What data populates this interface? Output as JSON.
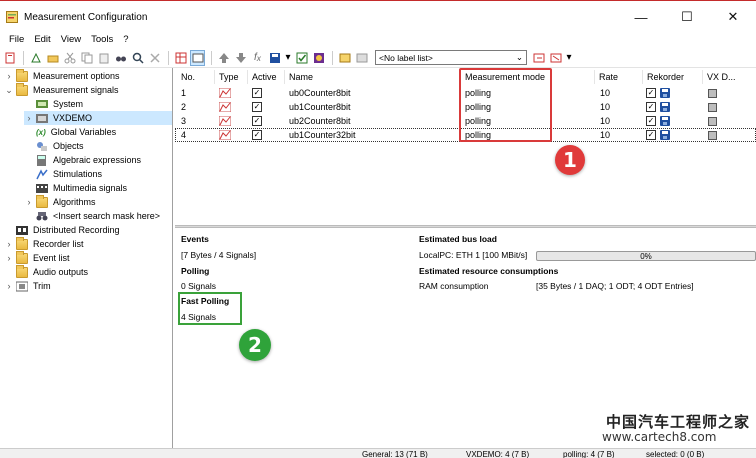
{
  "window": {
    "title": "Measurement Configuration",
    "minimize": "—",
    "maximize": "☐",
    "close": "✕"
  },
  "menu": [
    "File",
    "Edit",
    "View",
    "Tools",
    "?"
  ],
  "toolbar": {
    "label_list": "<No label list>"
  },
  "tree": {
    "items": [
      {
        "label": "Measurement options",
        "chev": "›"
      },
      {
        "label": "Measurement signals",
        "chev": "⌄"
      },
      {
        "label": "System",
        "chev": ""
      },
      {
        "label": "VXDEMO",
        "chev": "›"
      },
      {
        "label": "Global Variables",
        "chev": "",
        "prefix": "(x)"
      },
      {
        "label": "Objects",
        "chev": ""
      },
      {
        "label": "Algebraic expressions",
        "chev": ""
      },
      {
        "label": "Stimulations",
        "chev": ""
      },
      {
        "label": "Multimedia signals",
        "chev": ""
      },
      {
        "label": "Algorithms",
        "chev": "›"
      },
      {
        "label": "<Insert search mask here>",
        "chev": ""
      },
      {
        "label": "Distributed Recording",
        "chev": ""
      },
      {
        "label": "Recorder list",
        "chev": "›"
      },
      {
        "label": "Event list",
        "chev": "›"
      },
      {
        "label": "Audio outputs",
        "chev": ""
      },
      {
        "label": "Trim",
        "chev": "›"
      }
    ]
  },
  "grid": {
    "headers": [
      "No.",
      "Type",
      "Active",
      "Name",
      "Measurement mode",
      "Rate",
      "Rekorder",
      "VX D..."
    ],
    "rows": [
      {
        "no": "1",
        "active": "✓",
        "name": "ub0Counter8bit",
        "mode": "polling",
        "rate": "10",
        "rec": "✓"
      },
      {
        "no": "2",
        "active": "✓",
        "name": "ub1Counter8bit",
        "mode": "polling",
        "rate": "10",
        "rec": "✓"
      },
      {
        "no": "3",
        "active": "✓",
        "name": "ub2Counter8bit",
        "mode": "polling",
        "rate": "10",
        "rec": "✓"
      },
      {
        "no": "4",
        "active": "✓",
        "name": "ub1Counter32bit",
        "mode": "polling",
        "rate": "10",
        "rec": "✓"
      }
    ]
  },
  "markers": {
    "one": "1",
    "two": "2"
  },
  "panel": {
    "events_title": "Events",
    "events_value": "[7 Bytes / 4 Signals]",
    "polling_title": "Polling",
    "polling_value": "0 Signals",
    "fast_title": "Fast Polling",
    "fast_value": "4 Signals",
    "busload_title": "Estimated bus load",
    "busload_label": "LocalPC: ETH 1 [100 MBit/s]",
    "busload_percent": "0%",
    "busload_fraction": 0,
    "resource_title": "Estimated resource consumptions",
    "ram_label": "RAM consumption",
    "ram_value": "[35 Bytes / 1 DAQ; 1 ODT; 4 ODT Entries]"
  },
  "statusbar": {
    "general": "General: 13 (71 B)",
    "vxdemo": "VXDEMO: 4 (7 B)",
    "polling": "polling: 4 (7 B)",
    "selected": "selected: 0 (0 B)"
  },
  "watermark": {
    "line1": "中国汽车工程师之家",
    "line2": "www.cartech8.com"
  },
  "colors": {
    "accent_red": "#d93a3a",
    "accent_green": "#3aa23a",
    "selection": "#cce8ff"
  }
}
